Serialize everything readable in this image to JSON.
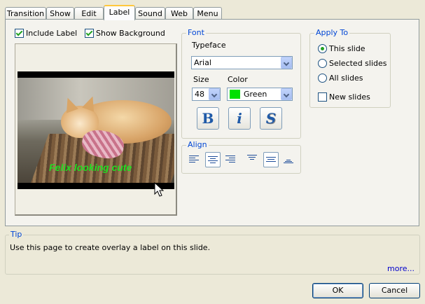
{
  "tabs": [
    {
      "label": "Transition"
    },
    {
      "label": "Show"
    },
    {
      "label": "Edit"
    },
    {
      "label": "Label",
      "active": true
    },
    {
      "label": "Sound"
    },
    {
      "label": "Web"
    },
    {
      "label": "Menu"
    }
  ],
  "options": {
    "include_label": {
      "label": "Include Label",
      "checked": true
    },
    "show_background": {
      "label": "Show Background",
      "checked": true
    }
  },
  "preview": {
    "caption": "Felix looking cute",
    "caption_color": "#22DD22"
  },
  "font": {
    "legend": "Font",
    "typeface_label": "Typeface",
    "typeface_value": "Arial",
    "size_label": "Size",
    "size_value": "48",
    "color_label": "Color",
    "color_value": "Green",
    "color_swatch": "#00E000",
    "bold": "B",
    "italic": "i",
    "shadow": "S"
  },
  "align": {
    "legend": "Align"
  },
  "apply_to": {
    "legend": "Apply To",
    "this_slide": "This slide",
    "selected_slides": "Selected slides",
    "all_slides": "All slides",
    "new_slides": "New slides",
    "selected": "this_slide"
  },
  "tip": {
    "legend": "Tip",
    "text": "Use this page to create overlay a label on this slide.",
    "more": "more..."
  },
  "buttons": {
    "ok": "OK",
    "cancel": "Cancel"
  }
}
